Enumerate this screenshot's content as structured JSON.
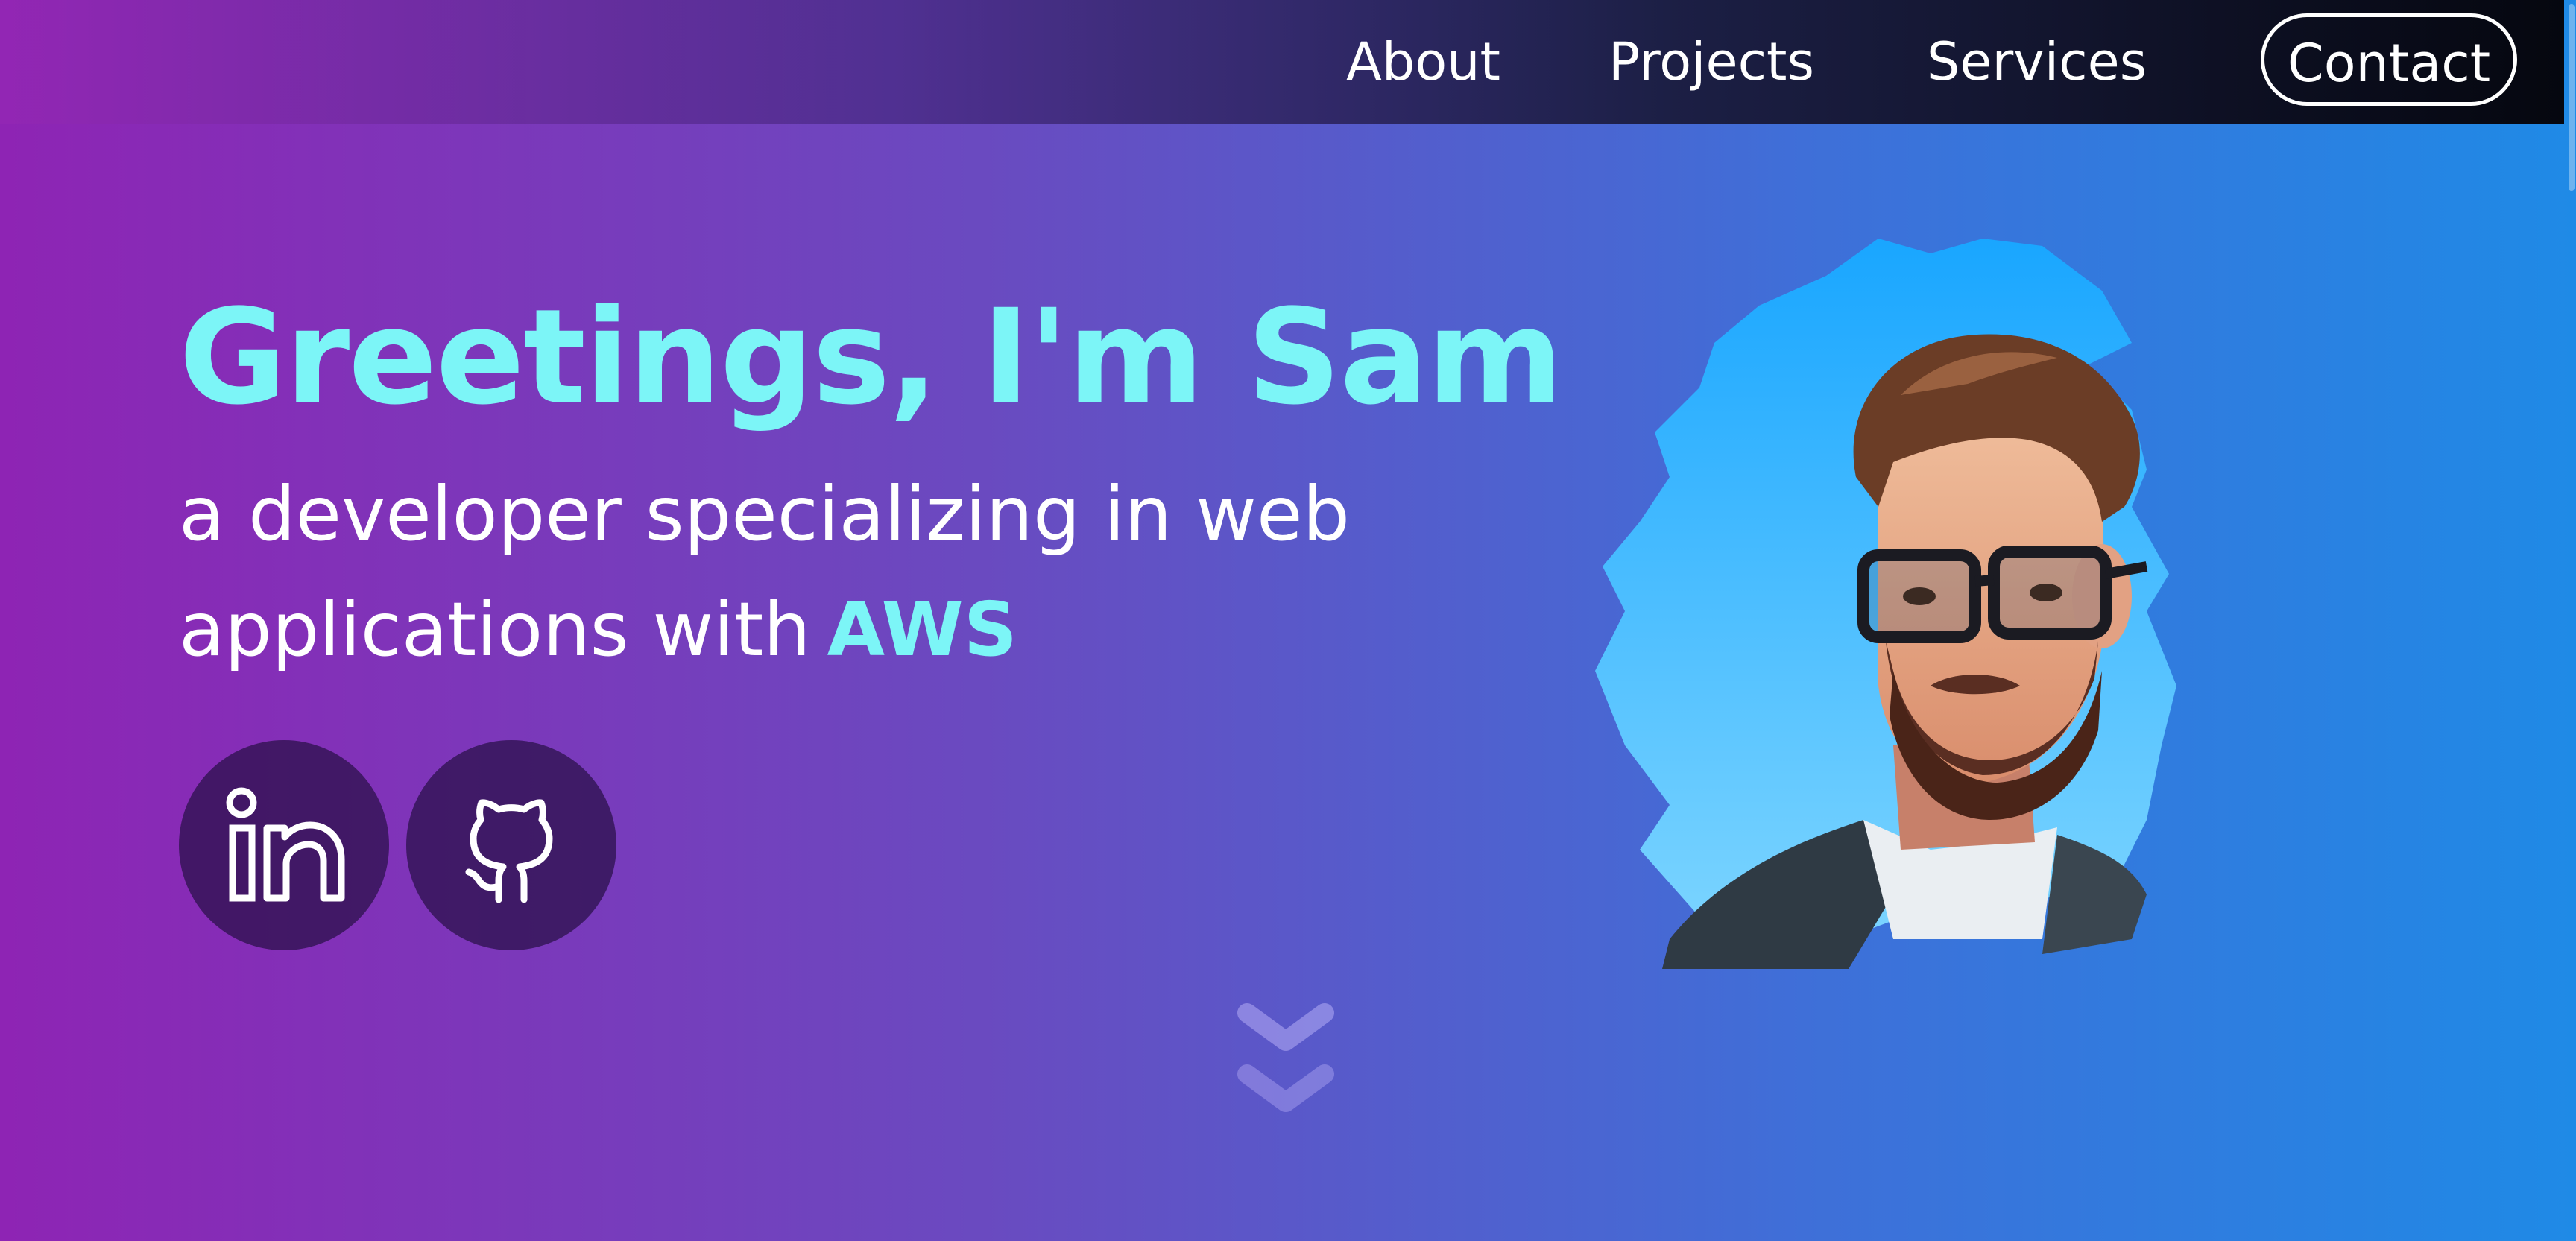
{
  "nav": {
    "about": "About",
    "projects": "Projects",
    "services": "Services",
    "contact": "Contact"
  },
  "hero": {
    "greeting": "Greetings, I'm Sam",
    "subtitle_line1": "a developer specializing in web",
    "subtitle_line2": "applications with",
    "subtitle_accent": "AWS"
  },
  "social": [
    {
      "icon": "linkedin-icon"
    },
    {
      "icon": "github-icon"
    }
  ],
  "icons": {
    "scroll": "chevron-double-down-icon"
  },
  "colors": {
    "accent": "#7cf5f7",
    "gradient_start": "#8e24b4",
    "gradient_end": "#1f8ae6",
    "nav_dark": "#05070f",
    "social_bg": "#2a0f46"
  }
}
